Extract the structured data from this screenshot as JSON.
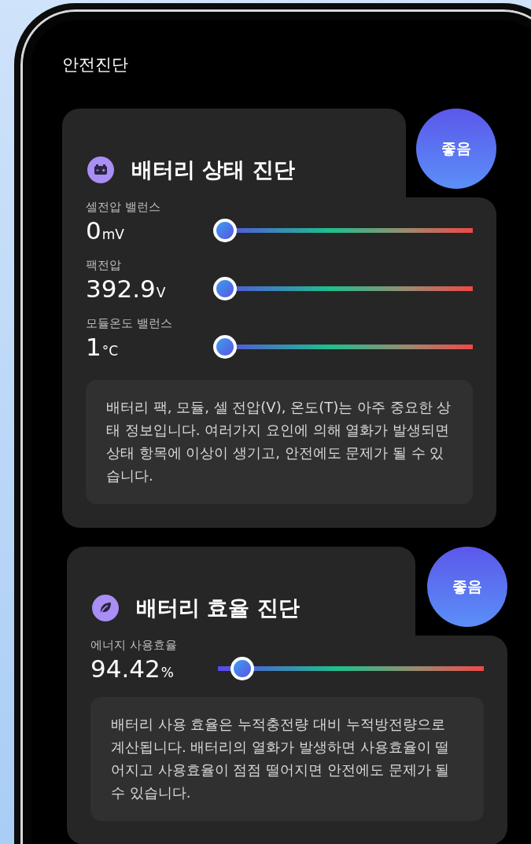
{
  "screen": {
    "title": "안전진단"
  },
  "cards": [
    {
      "kind": "battery",
      "title": "배터리 상태 진단",
      "badge": "좋음",
      "metrics": [
        {
          "label": "셀전압 밸런스",
          "value": "0",
          "unit": "mV",
          "level": 0
        },
        {
          "label": "팩전압",
          "value": "392.9",
          "unit": "V",
          "level": 0
        },
        {
          "label": "모듈온도 밸런스",
          "value": "1",
          "unit": "°C",
          "level": 0
        }
      ],
      "description": "배터리 팩, 모듈, 셀 전압(V), 온도(T)는 아주 중요한 상태 정보입니다. 여러가지 요인에 의해 열화가 발생되면 상태 항목에 이상이 생기고, 안전에도 문제가 될 수 있습니다."
    },
    {
      "kind": "leaf",
      "title": "배터리 효율 진단",
      "badge": "좋음",
      "metrics": [
        {
          "label": "에너지 사용효율",
          "value": "94.42",
          "unit": "%",
          "level": 0.05
        }
      ],
      "description": "배터리 사용 효율은 누적충전량 대비 누적방전량으로 계산됩니다. 배터리의 열화가 발생하면 사용효율이 떨어지고 사용효율이 점점 떨어지면 안전에도 문제가 될 수 있습니다."
    }
  ]
}
